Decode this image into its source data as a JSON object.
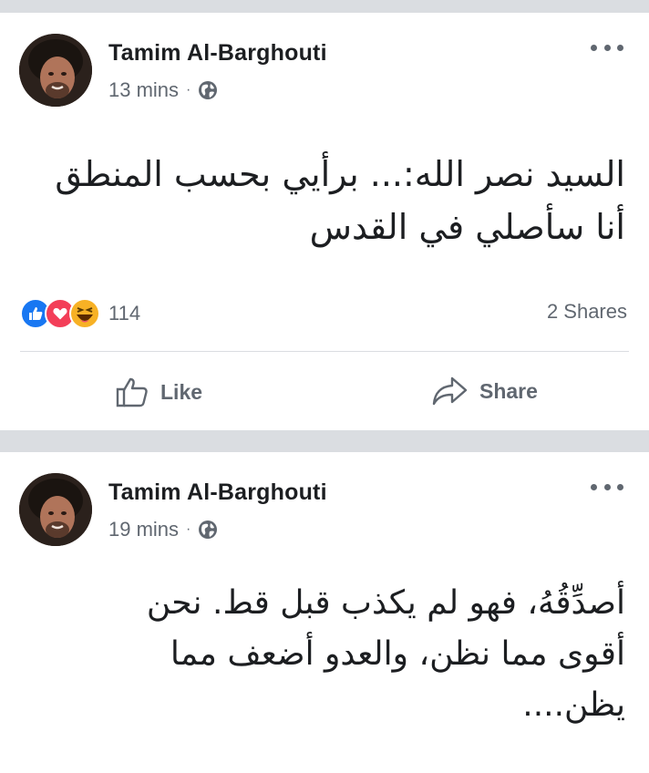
{
  "posts": [
    {
      "author": "Tamim Al-Barghouti",
      "time": "13 mins",
      "separator": "·",
      "lines": [
        "السيد نصر الله:... برأيي بحسب المنطق",
        "أنا سأصلي في القدس"
      ],
      "reaction_count": "114",
      "reactions": [
        "like-icon",
        "love-icon",
        "haha-icon"
      ],
      "shares": "2 Shares",
      "actions": {
        "like_label": "Like",
        "share_label": "Share"
      }
    },
    {
      "author": "Tamim Al-Barghouti",
      "time": "19 mins",
      "separator": "·",
      "lines": [
        "أصدِّقُهُ، فهو لم يكذب قبل قط. نحن",
        "أقوى مما نظن، والعدو أضعف مما",
        "يظن...."
      ]
    }
  ],
  "colors": {
    "background": "#dadde1",
    "card": "#ffffff",
    "author_text": "#1c1e21",
    "meta_text": "#606770",
    "like_blue": "#1877f2",
    "love_red": "#f33e58",
    "haha_yellow": "#f7b125"
  },
  "icons": {
    "privacy": "globe-icon",
    "more": "more-options-icon",
    "like_action": "thumbs-up-icon",
    "share_action": "share-arrow-icon"
  }
}
